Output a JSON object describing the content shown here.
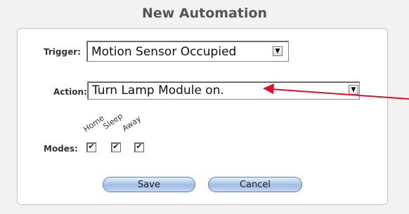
{
  "title": "New Automation",
  "trigger": {
    "label": "Trigger:",
    "value": "Motion Sensor Occupied"
  },
  "action": {
    "label": "Action:",
    "value": "Turn Lamp Module on."
  },
  "modes": {
    "label": "Modes:",
    "options": [
      {
        "name": "Home",
        "checked": true
      },
      {
        "name": "Sleep",
        "checked": true
      },
      {
        "name": "Away",
        "checked": true
      }
    ],
    "check_glyph": "✔"
  },
  "buttons": {
    "save": "Save",
    "cancel": "Cancel"
  },
  "colors": {
    "annotation_arrow": "#e0102a",
    "button_border": "#5a7fb5"
  }
}
